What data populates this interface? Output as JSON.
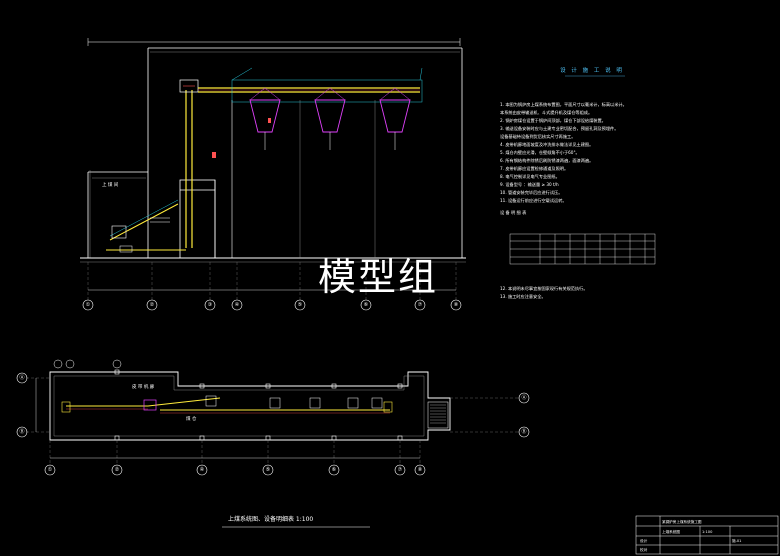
{
  "drawing": {
    "elevation_axes": [
      "①",
      "②",
      "③",
      "④",
      "⑤",
      "⑥",
      "⑦",
      "⑧"
    ],
    "plan_axes_bottom": [
      "①",
      "②",
      "③",
      "④",
      "⑤",
      "⑥",
      "⑦",
      "⑧"
    ],
    "plan_axes_left": [
      "Ⓐ",
      "Ⓑ"
    ],
    "plan_axes_right": [
      "Ⓐ",
      "Ⓑ"
    ],
    "room_labels": {
      "elevation_left": "上 煤 间",
      "plan_conveyor": "皮 带 机 廊",
      "plan_coal": "煤 仓"
    },
    "watermark": "模型组",
    "plan_caption": "上煤系统图、设备明细表 1:100"
  },
  "notes": {
    "title": "设 计 施 工 说 明",
    "items": [
      "1. 本图为锅炉房上煤系统布置图，平面尺寸以毫米计，标高以米计。",
      "   本系统由皮带输送机、斗式提升机及煤仓等组成。",
      "2. 锅炉房煤仓设置于锅炉间顶部，煤仓下部设给煤装置。",
      "3. 输送设备安装时应与土建专业密切配合，预留孔洞及预埋件。",
      "   设备基础待设备到货后核实尺寸再施工。",
      "4. 皮带机廊地面坡度及冲洗排水做法详见土建图。",
      "5. 煤仓内壁应光滑，仓壁倾角不小于60°。",
      "6. 所有钢结构件除锈后刷防锈漆两遍，面漆两遍。",
      "7. 皮带机廊应设置检修通道及照明。",
      "8. 电气控制详见电气专业图纸。",
      "9. 设备型号 ：输送量 ≥ 30 t/h",
      "10. 管道安装完毕后应进行试压。",
      "11. 设备运行前应进行空载试运转。",
      "12. 本说明未尽事宜按国家现行有关规范执行。",
      "13. 施工时应注意安全。"
    ],
    "table_header": "设 备 明 细 表"
  },
  "title_block": {
    "project": "某锅炉房上煤系统施工图",
    "drawing_name": "上煤系统图",
    "scale": "1:100",
    "sheet": "施-01",
    "designer": "设计",
    "checker": "校对"
  }
}
